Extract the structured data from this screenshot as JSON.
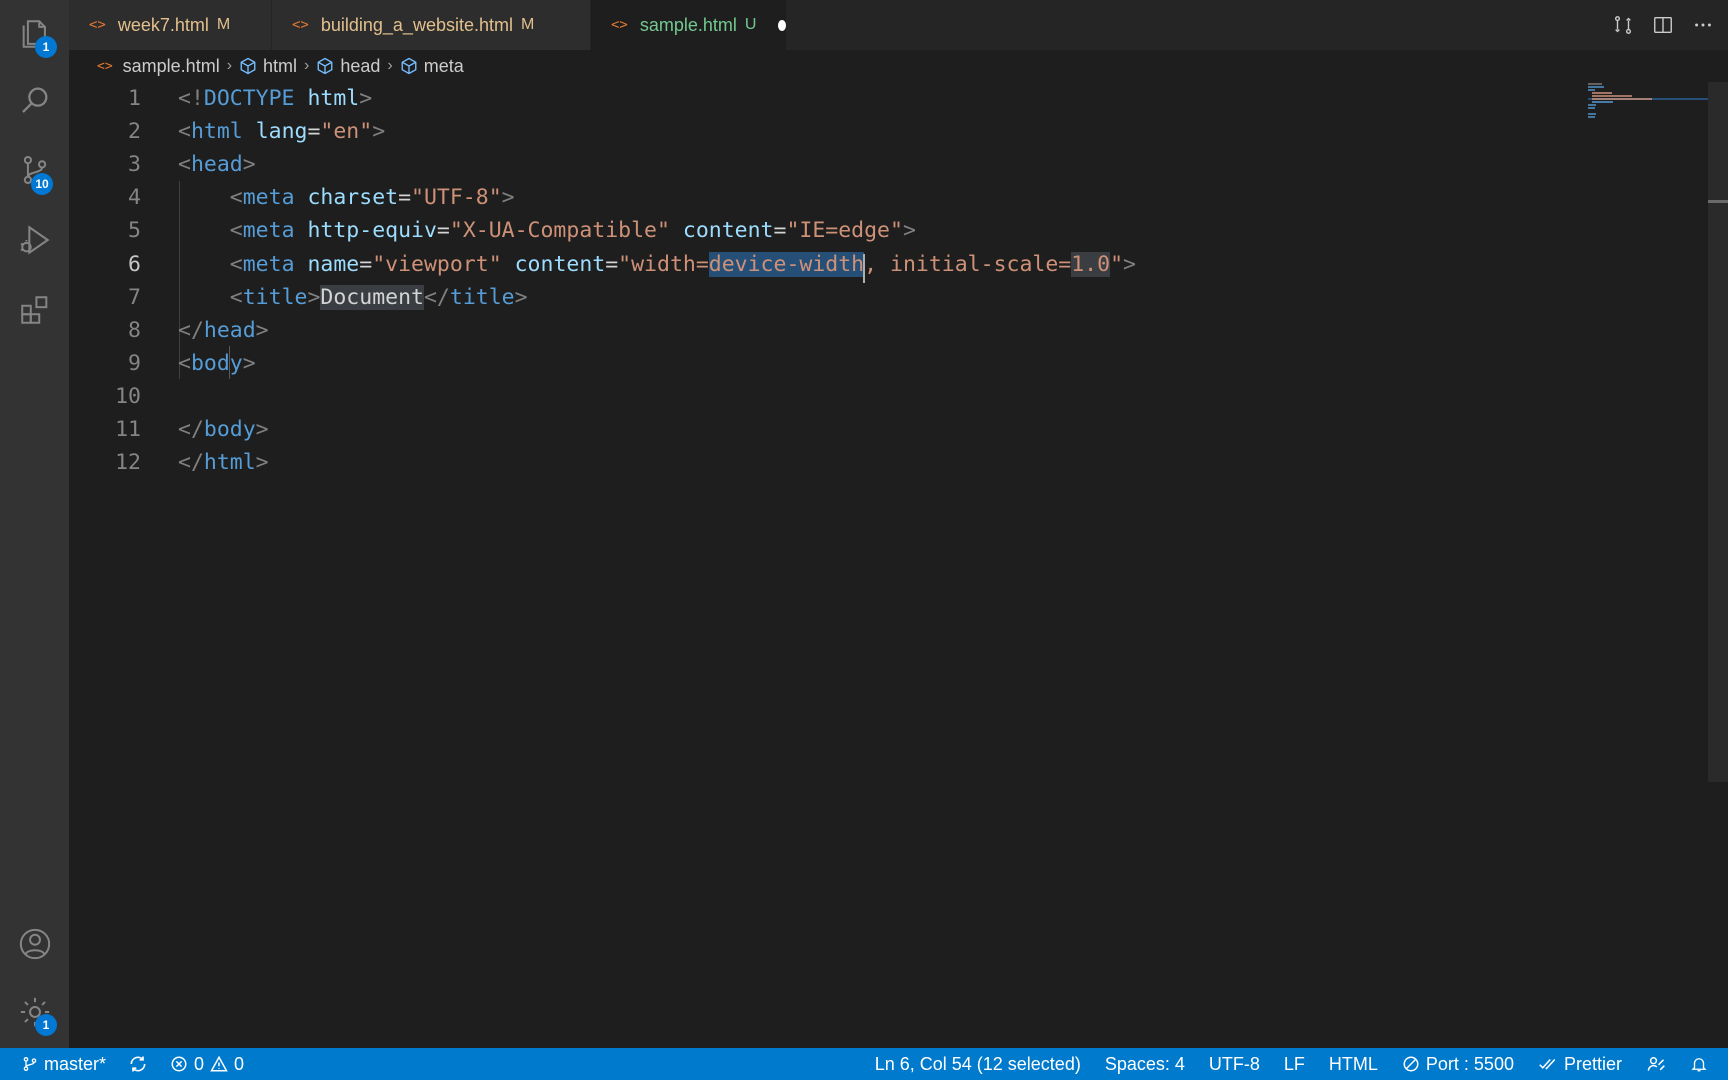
{
  "activity_bar": {
    "explorer_badge": "1",
    "source_control_badge": "10",
    "manage_badge": "1"
  },
  "tabs": [
    {
      "name": "week7.html",
      "status": "M",
      "active": false
    },
    {
      "name": "building_a_website.html",
      "status": "M",
      "active": false
    },
    {
      "name": "sample.html",
      "status": "U",
      "active": true,
      "dirty": true
    }
  ],
  "breadcrumb": [
    "sample.html",
    "html",
    "head",
    "meta"
  ],
  "editor": {
    "current_line": 6,
    "lines": [
      [
        [
          "p",
          "<!"
        ],
        [
          "t",
          "DOCTYPE"
        ],
        [
          "x",
          " "
        ],
        [
          "a",
          "html"
        ],
        [
          "p",
          ">"
        ]
      ],
      [
        [
          "p",
          "<"
        ],
        [
          "t",
          "html"
        ],
        [
          "x",
          " "
        ],
        [
          "a",
          "lang"
        ],
        [
          "x",
          "="
        ],
        [
          "s",
          "\"en\""
        ],
        [
          "p",
          ">"
        ]
      ],
      [
        [
          "p",
          "<"
        ],
        [
          "t",
          "head"
        ],
        [
          "p",
          ">"
        ]
      ],
      [
        [
          "x",
          "    "
        ],
        [
          "p",
          "<"
        ],
        [
          "t",
          "meta"
        ],
        [
          "x",
          " "
        ],
        [
          "a",
          "charset"
        ],
        [
          "x",
          "="
        ],
        [
          "s",
          "\"UTF-8\""
        ],
        [
          "p",
          ">"
        ]
      ],
      [
        [
          "x",
          "    "
        ],
        [
          "p",
          "<"
        ],
        [
          "t",
          "meta"
        ],
        [
          "x",
          " "
        ],
        [
          "a",
          "http-equiv"
        ],
        [
          "x",
          "="
        ],
        [
          "s",
          "\"X-UA-Compatible\""
        ],
        [
          "x",
          " "
        ],
        [
          "a",
          "content"
        ],
        [
          "x",
          "="
        ],
        [
          "s",
          "\"IE=edge\""
        ],
        [
          "p",
          ">"
        ]
      ],
      [
        [
          "x",
          "    "
        ],
        [
          "p",
          "<"
        ],
        [
          "t",
          "meta"
        ],
        [
          "x",
          " "
        ],
        [
          "a",
          "name"
        ],
        [
          "x",
          "="
        ],
        [
          "s",
          "\"viewport\""
        ],
        [
          "x",
          " "
        ],
        [
          "a",
          "content"
        ],
        [
          "x",
          "="
        ],
        [
          "s",
          "\"width="
        ],
        [
          "s",
          "device-width",
          "sel"
        ],
        [
          "s",
          ", initial-scale="
        ],
        [
          "s",
          "1.0",
          "hl"
        ],
        [
          "s",
          "\""
        ],
        [
          "p",
          ">"
        ]
      ],
      [
        [
          "x",
          "    "
        ],
        [
          "p",
          "<"
        ],
        [
          "t",
          "title"
        ],
        [
          "p",
          ">"
        ],
        [
          "x",
          "Document",
          "hl"
        ],
        [
          "p",
          "</"
        ],
        [
          "t",
          "title"
        ],
        [
          "p",
          ">"
        ]
      ],
      [
        [
          "p",
          "</"
        ],
        [
          "t",
          "head"
        ],
        [
          "p",
          ">"
        ]
      ],
      [
        [
          "p",
          "<"
        ],
        [
          "t",
          "body"
        ],
        [
          "p",
          ">"
        ]
      ],
      [],
      [
        [
          "p",
          "</"
        ],
        [
          "t",
          "body"
        ],
        [
          "p",
          ">"
        ]
      ],
      [
        [
          "p",
          "</"
        ],
        [
          "t",
          "html"
        ],
        [
          "p",
          ">"
        ]
      ]
    ]
  },
  "status_bar": {
    "branch": "master*",
    "errors": "0",
    "warnings": "0",
    "cursor_position": "Ln 6, Col 54 (12 selected)",
    "indentation": "Spaces: 4",
    "encoding": "UTF-8",
    "eol": "LF",
    "language": "HTML",
    "live_server": "Port : 5500",
    "formatter": "Prettier"
  },
  "colors": {
    "accent": "#007acc",
    "badge": "#0078d4",
    "modified": "#e2c08d",
    "untracked": "#73c991",
    "selection": "#264f78"
  }
}
